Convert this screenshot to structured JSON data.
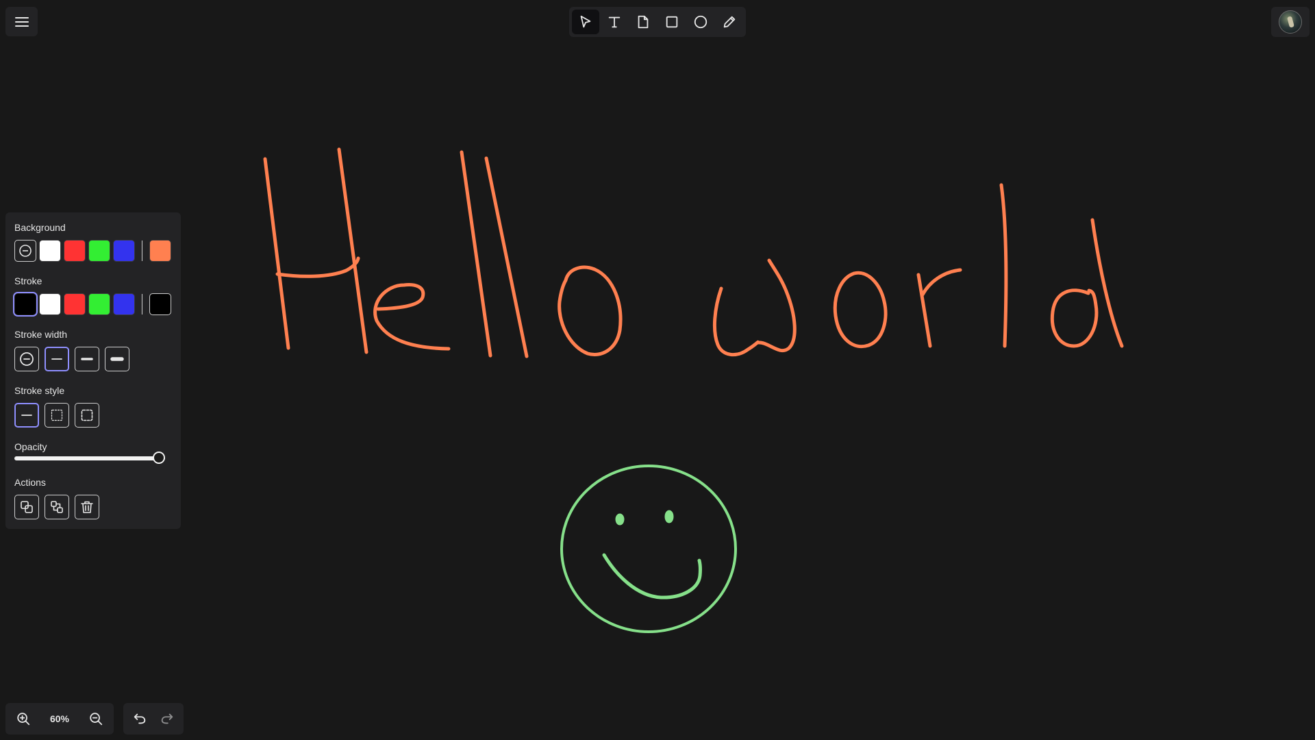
{
  "toolbar": {
    "tools": [
      "select-tool",
      "text-tool",
      "sticky-note-tool",
      "rectangle-tool",
      "ellipse-tool",
      "pen-tool"
    ],
    "active_tool": "select-tool"
  },
  "properties": {
    "background": {
      "label": "Background",
      "swatches": [
        "none",
        "#ffffff",
        "#ff3333",
        "#33ee33",
        "#3333ee"
      ],
      "custom": "#ff8050"
    },
    "stroke": {
      "label": "Stroke",
      "swatches": [
        "#000000",
        "#ffffff",
        "#ff3333",
        "#33ee33",
        "#3333ee"
      ],
      "selected": "#000000",
      "custom": "#000000"
    },
    "stroke_width": {
      "label": "Stroke width",
      "options": [
        "none",
        "thin",
        "medium",
        "thick"
      ],
      "selected": "thin"
    },
    "stroke_style": {
      "label": "Stroke style",
      "options": [
        "solid",
        "dashed",
        "dotted"
      ],
      "selected": "solid"
    },
    "opacity": {
      "label": "Opacity",
      "value": 1.0
    },
    "actions": {
      "label": "Actions",
      "items": [
        "duplicate",
        "group",
        "delete"
      ]
    }
  },
  "zoom": {
    "level": "60%"
  },
  "drawing": {
    "text_stroke_color": "#ff8050",
    "smiley_stroke_color": "#86e08a"
  }
}
